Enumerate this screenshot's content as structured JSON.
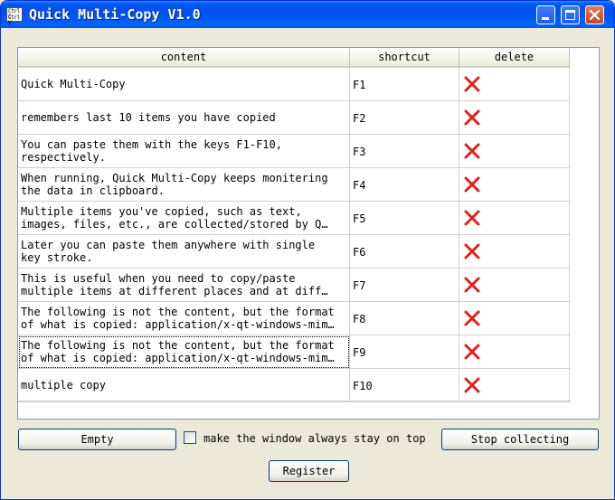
{
  "window": {
    "title": "Quick Multi-Copy V1.0",
    "icon_text": [
      "Ctrl C",
      "Ctrl V"
    ]
  },
  "table": {
    "columns": [
      "content",
      "shortcut",
      "delete"
    ],
    "rows": [
      {
        "content": [
          "Quick Multi-Copy"
        ],
        "shortcut": "F1"
      },
      {
        "content": [
          "remembers last 10 items you have copied"
        ],
        "shortcut": "F2"
      },
      {
        "content": [
          "You can paste them with the keys F1-F10,",
          "respectively."
        ],
        "shortcut": "F3"
      },
      {
        "content": [
          "When running, Quick Multi-Copy keeps monitering",
          "the data in clipboard."
        ],
        "shortcut": "F4"
      },
      {
        "content": [
          "Multiple items you've copied, such as text,",
          "images, files, etc., are collected/stored by Q…"
        ],
        "shortcut": "F5"
      },
      {
        "content": [
          "Later you can paste them anywhere with single",
          "key stroke."
        ],
        "shortcut": "F6"
      },
      {
        "content": [
          "This is useful when you need to copy/paste",
          "multiple items at different places and at diff…"
        ],
        "shortcut": "F7"
      },
      {
        "content": [
          "The following is not the content, but the format",
          "of what is copied: application/x-qt-windows-mim…"
        ],
        "shortcut": "F8"
      },
      {
        "content": [
          "The following is not the content, but the format",
          "of what is copied: application/x-qt-windows-mim…"
        ],
        "shortcut": "F9"
      },
      {
        "content": [
          "multiple copy"
        ],
        "shortcut": "F10"
      }
    ],
    "delete_icon": "red-x-icon",
    "delete_color": "#e0201b"
  },
  "controls": {
    "empty_label": "Empty",
    "always_on_top_label": "make the window always stay on top",
    "always_on_top_checked": false,
    "stop_label": "Stop collecting",
    "register_label": "Register"
  }
}
